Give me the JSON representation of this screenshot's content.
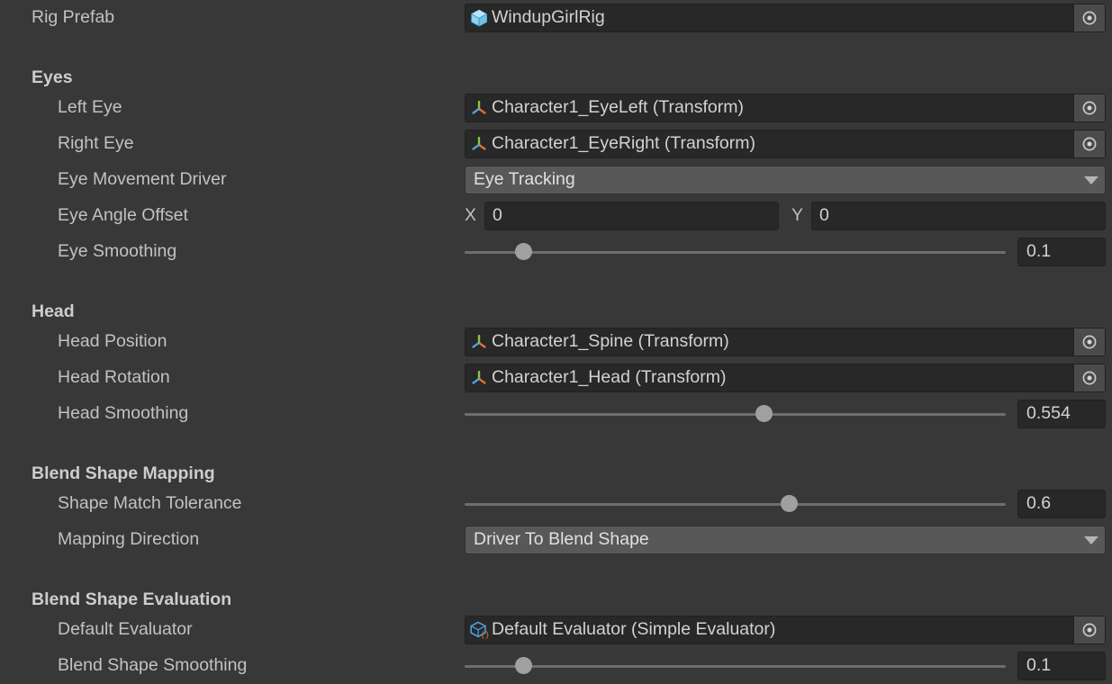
{
  "rows": [
    {
      "id": "rig-prefab",
      "kind": "object",
      "label": "Rig Prefab",
      "indent": "none",
      "value": "WindupGirlRig",
      "icon": "prefab-cube-icon",
      "picker": "object-picker-icon"
    },
    {
      "id": "eyes-header",
      "kind": "header",
      "label": "Eyes"
    },
    {
      "id": "left-eye",
      "kind": "object",
      "label": "Left Eye",
      "indent": "field",
      "value": "Character1_EyeLeft (Transform)",
      "icon": "transform-gizmo-icon",
      "picker": "object-picker-icon"
    },
    {
      "id": "right-eye",
      "kind": "object",
      "label": "Right Eye",
      "indent": "field",
      "value": "Character1_EyeRight (Transform)",
      "icon": "transform-gizmo-icon",
      "picker": "object-picker-icon"
    },
    {
      "id": "eye-movement-driver",
      "kind": "dropdown",
      "label": "Eye Movement Driver",
      "indent": "field",
      "value": "Eye Tracking"
    },
    {
      "id": "eye-angle-offset",
      "kind": "vector2",
      "label": "Eye Angle Offset",
      "indent": "field",
      "x_axis": "X",
      "x_value": "0",
      "y_axis": "Y",
      "y_value": "0"
    },
    {
      "id": "eye-smoothing",
      "kind": "slider",
      "label": "Eye Smoothing",
      "indent": "field",
      "value": "0.1",
      "fraction": 0.11
    },
    {
      "id": "head-header",
      "kind": "header",
      "label": "Head"
    },
    {
      "id": "head-position",
      "kind": "object",
      "label": "Head Position",
      "indent": "field",
      "value": "Character1_Spine (Transform)",
      "icon": "transform-gizmo-icon",
      "picker": "object-picker-icon"
    },
    {
      "id": "head-rotation",
      "kind": "object",
      "label": "Head Rotation",
      "indent": "field",
      "value": "Character1_Head (Transform)",
      "icon": "transform-gizmo-icon",
      "picker": "object-picker-icon"
    },
    {
      "id": "head-smoothing",
      "kind": "slider",
      "label": "Head Smoothing",
      "indent": "field",
      "value": "0.554",
      "fraction": 0.554
    },
    {
      "id": "blend-shape-mapping-header",
      "kind": "header",
      "label": "Blend Shape Mapping"
    },
    {
      "id": "shape-match-tolerance",
      "kind": "slider",
      "label": "Shape Match Tolerance",
      "indent": "field",
      "value": "0.6",
      "fraction": 0.6
    },
    {
      "id": "mapping-direction",
      "kind": "dropdown",
      "label": "Mapping Direction",
      "indent": "field",
      "value": "Driver To Blend Shape"
    },
    {
      "id": "blend-shape-evaluation-header",
      "kind": "header",
      "label": "Blend Shape Evaluation"
    },
    {
      "id": "default-evaluator",
      "kind": "object",
      "label": "Default Evaluator",
      "indent": "field",
      "value": "Default Evaluator (Simple Evaluator)",
      "icon": "scriptable-object-icon",
      "picker": "object-picker-icon"
    },
    {
      "id": "blend-shape-smoothing",
      "kind": "slider",
      "label": "Blend Shape Smoothing",
      "indent": "field",
      "value": "0.1",
      "fraction": 0.11
    }
  ],
  "colors": {
    "background": "#383838",
    "field_background": "#282828",
    "dropdown_background": "#585858",
    "label_text": "#c2c2c2",
    "value_text": "#d2d2d2",
    "slider_track": "#6e6e6e",
    "slider_knob": "#a0a0a0",
    "prefab_icon": "#7ec8f0",
    "gizmo_green": "#8cc63f",
    "gizmo_blue": "#4aa3df",
    "gizmo_orange": "#e2703a",
    "script_brace": "#e2703a"
  }
}
